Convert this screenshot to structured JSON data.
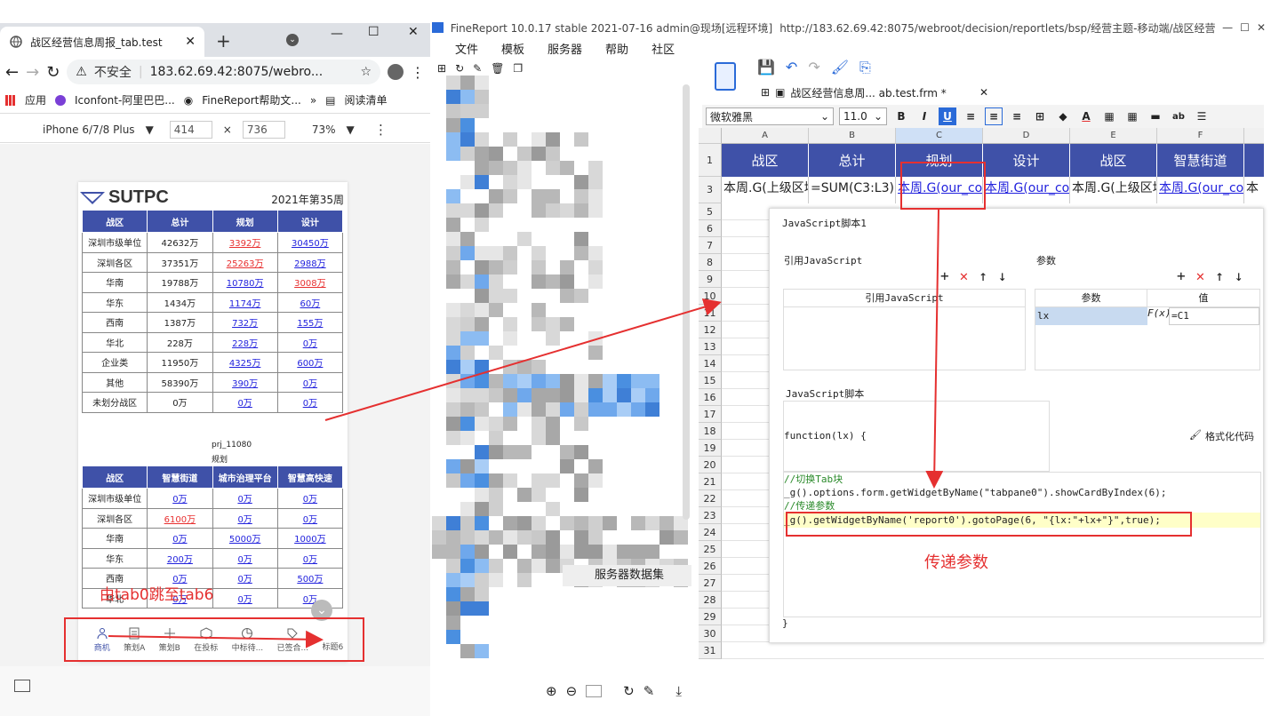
{
  "browser": {
    "tab_title": "战区经营信息周报_tab.test",
    "address_warning": "不安全",
    "url": "183.62.69.42:8075/webro...",
    "bookmarks": [
      "应用",
      "Iconfont-阿里巴巴...",
      "FineReport帮助文...",
      "阅读清单"
    ],
    "bookmarks_more": "»",
    "device": "iPhone 6/7/8 Plus",
    "width": "414",
    "height": "736",
    "times": "×",
    "zoom": "73%"
  },
  "report": {
    "logo": "SUTPC",
    "week": "2021年第35周",
    "table1": {
      "headers": [
        "战区",
        "总计",
        "规划",
        "设计"
      ],
      "rows": [
        [
          "深圳市级单位",
          "42632万",
          "3392万",
          "30450万"
        ],
        [
          "深圳各区",
          "37351万",
          "25263万",
          "2988万"
        ],
        [
          "华南",
          "19788万",
          "10780万",
          "3008万"
        ],
        [
          "华东",
          "1434万",
          "1174万",
          "60万"
        ],
        [
          "西南",
          "1387万",
          "732万",
          "155万"
        ],
        [
          "华北",
          "228万",
          "228万",
          "0万"
        ],
        [
          "企业类",
          "11950万",
          "4325万",
          "600万"
        ],
        [
          "其他",
          "58390万",
          "390万",
          "0万"
        ],
        [
          "未划分战区",
          "0万",
          "0万",
          "0万"
        ]
      ]
    },
    "caption_line1": "prj_11080",
    "caption_line2": "规划",
    "table2": {
      "headers": [
        "战区",
        "智慧街道",
        "城市治理平台",
        "智慧高快速"
      ],
      "rows": [
        [
          "深圳市级单位",
          "0万",
          "0万",
          "0万"
        ],
        [
          "深圳各区",
          "6100万",
          "0万",
          "0万"
        ],
        [
          "华南",
          "0万",
          "5000万",
          "1000万"
        ],
        [
          "华东",
          "200万",
          "0万",
          "0万"
        ],
        [
          "西南",
          "0万",
          "0万",
          "500万"
        ],
        [
          "华北",
          "0万",
          "0万",
          "0万"
        ]
      ]
    },
    "nav_items": [
      "商机",
      "策划A",
      "策划B",
      "在投标",
      "中标待...",
      "已签合...",
      "标题6"
    ]
  },
  "annotations": {
    "tab_jump": "由tab0跳至tab6",
    "pass_param": "传递参数"
  },
  "designer": {
    "title": "FineReport 10.0.17 stable 2021-07-16 admin@现场[远程环境]",
    "title_url": "http://183.62.69.42:8075/webroot/decision/reportlets/bsp/经营主题-移动端/战区经营信息周报_tab",
    "menus": [
      "文件",
      "模板",
      "服务器",
      "帮助",
      "社区"
    ],
    "file_tab": "战区经营信息周... ab.test.frm *",
    "font": "微软雅黑",
    "font_size": "11.0",
    "columns": [
      "A",
      "B",
      "C",
      "D",
      "E",
      "F",
      "G"
    ],
    "row_numbers": [
      "1",
      "3",
      "5",
      "6",
      "7",
      "8",
      "9",
      "10",
      "11",
      "12",
      "13",
      "14",
      "15",
      "16",
      "17",
      "18",
      "19",
      "20",
      "21",
      "22",
      "23",
      "24",
      "25",
      "26",
      "27",
      "28",
      "29",
      "30",
      "31"
    ],
    "header_cells": [
      "战区",
      "总计",
      "规划",
      "设计",
      "战区",
      "智慧街道",
      "城"
    ],
    "row3_cells": [
      "本周.G(上级区域名称)",
      "=SUM(C3:L3)",
      "本周.G(our_contract",
      "本周.G(our_contract",
      "本周.G(上级区域名称)",
      "本周.G(our_contract",
      "本"
    ],
    "side_label": "服务器数据集"
  },
  "dialog": {
    "title": "JavaScript脚本1",
    "ref_js_label": "引用JavaScript",
    "params_label": "参数",
    "ref_js_col": "引用JavaScript",
    "param_col": "参数",
    "value_col": "值",
    "param_name": "lx",
    "param_value": "=C1",
    "script_label": "JavaScript脚本",
    "func_header": "function(lx) {",
    "format_code": "格式化代码",
    "code": [
      "//切换Tab块",
      "_g().options.form.getWidgetByName(\"tabpane0\").showCardByIndex(6);",
      "//传递参数",
      "_g().getWidgetByName('report0').gotoPage(6, \"{lx:\"+lx+\"}\",true);"
    ],
    "close_brace": "}"
  },
  "colors": {
    "header_blue": "#3f51a8",
    "link_blue": "#2222dd",
    "alert_red": "#e53030",
    "highlight_yellow": "#ffffc8"
  }
}
